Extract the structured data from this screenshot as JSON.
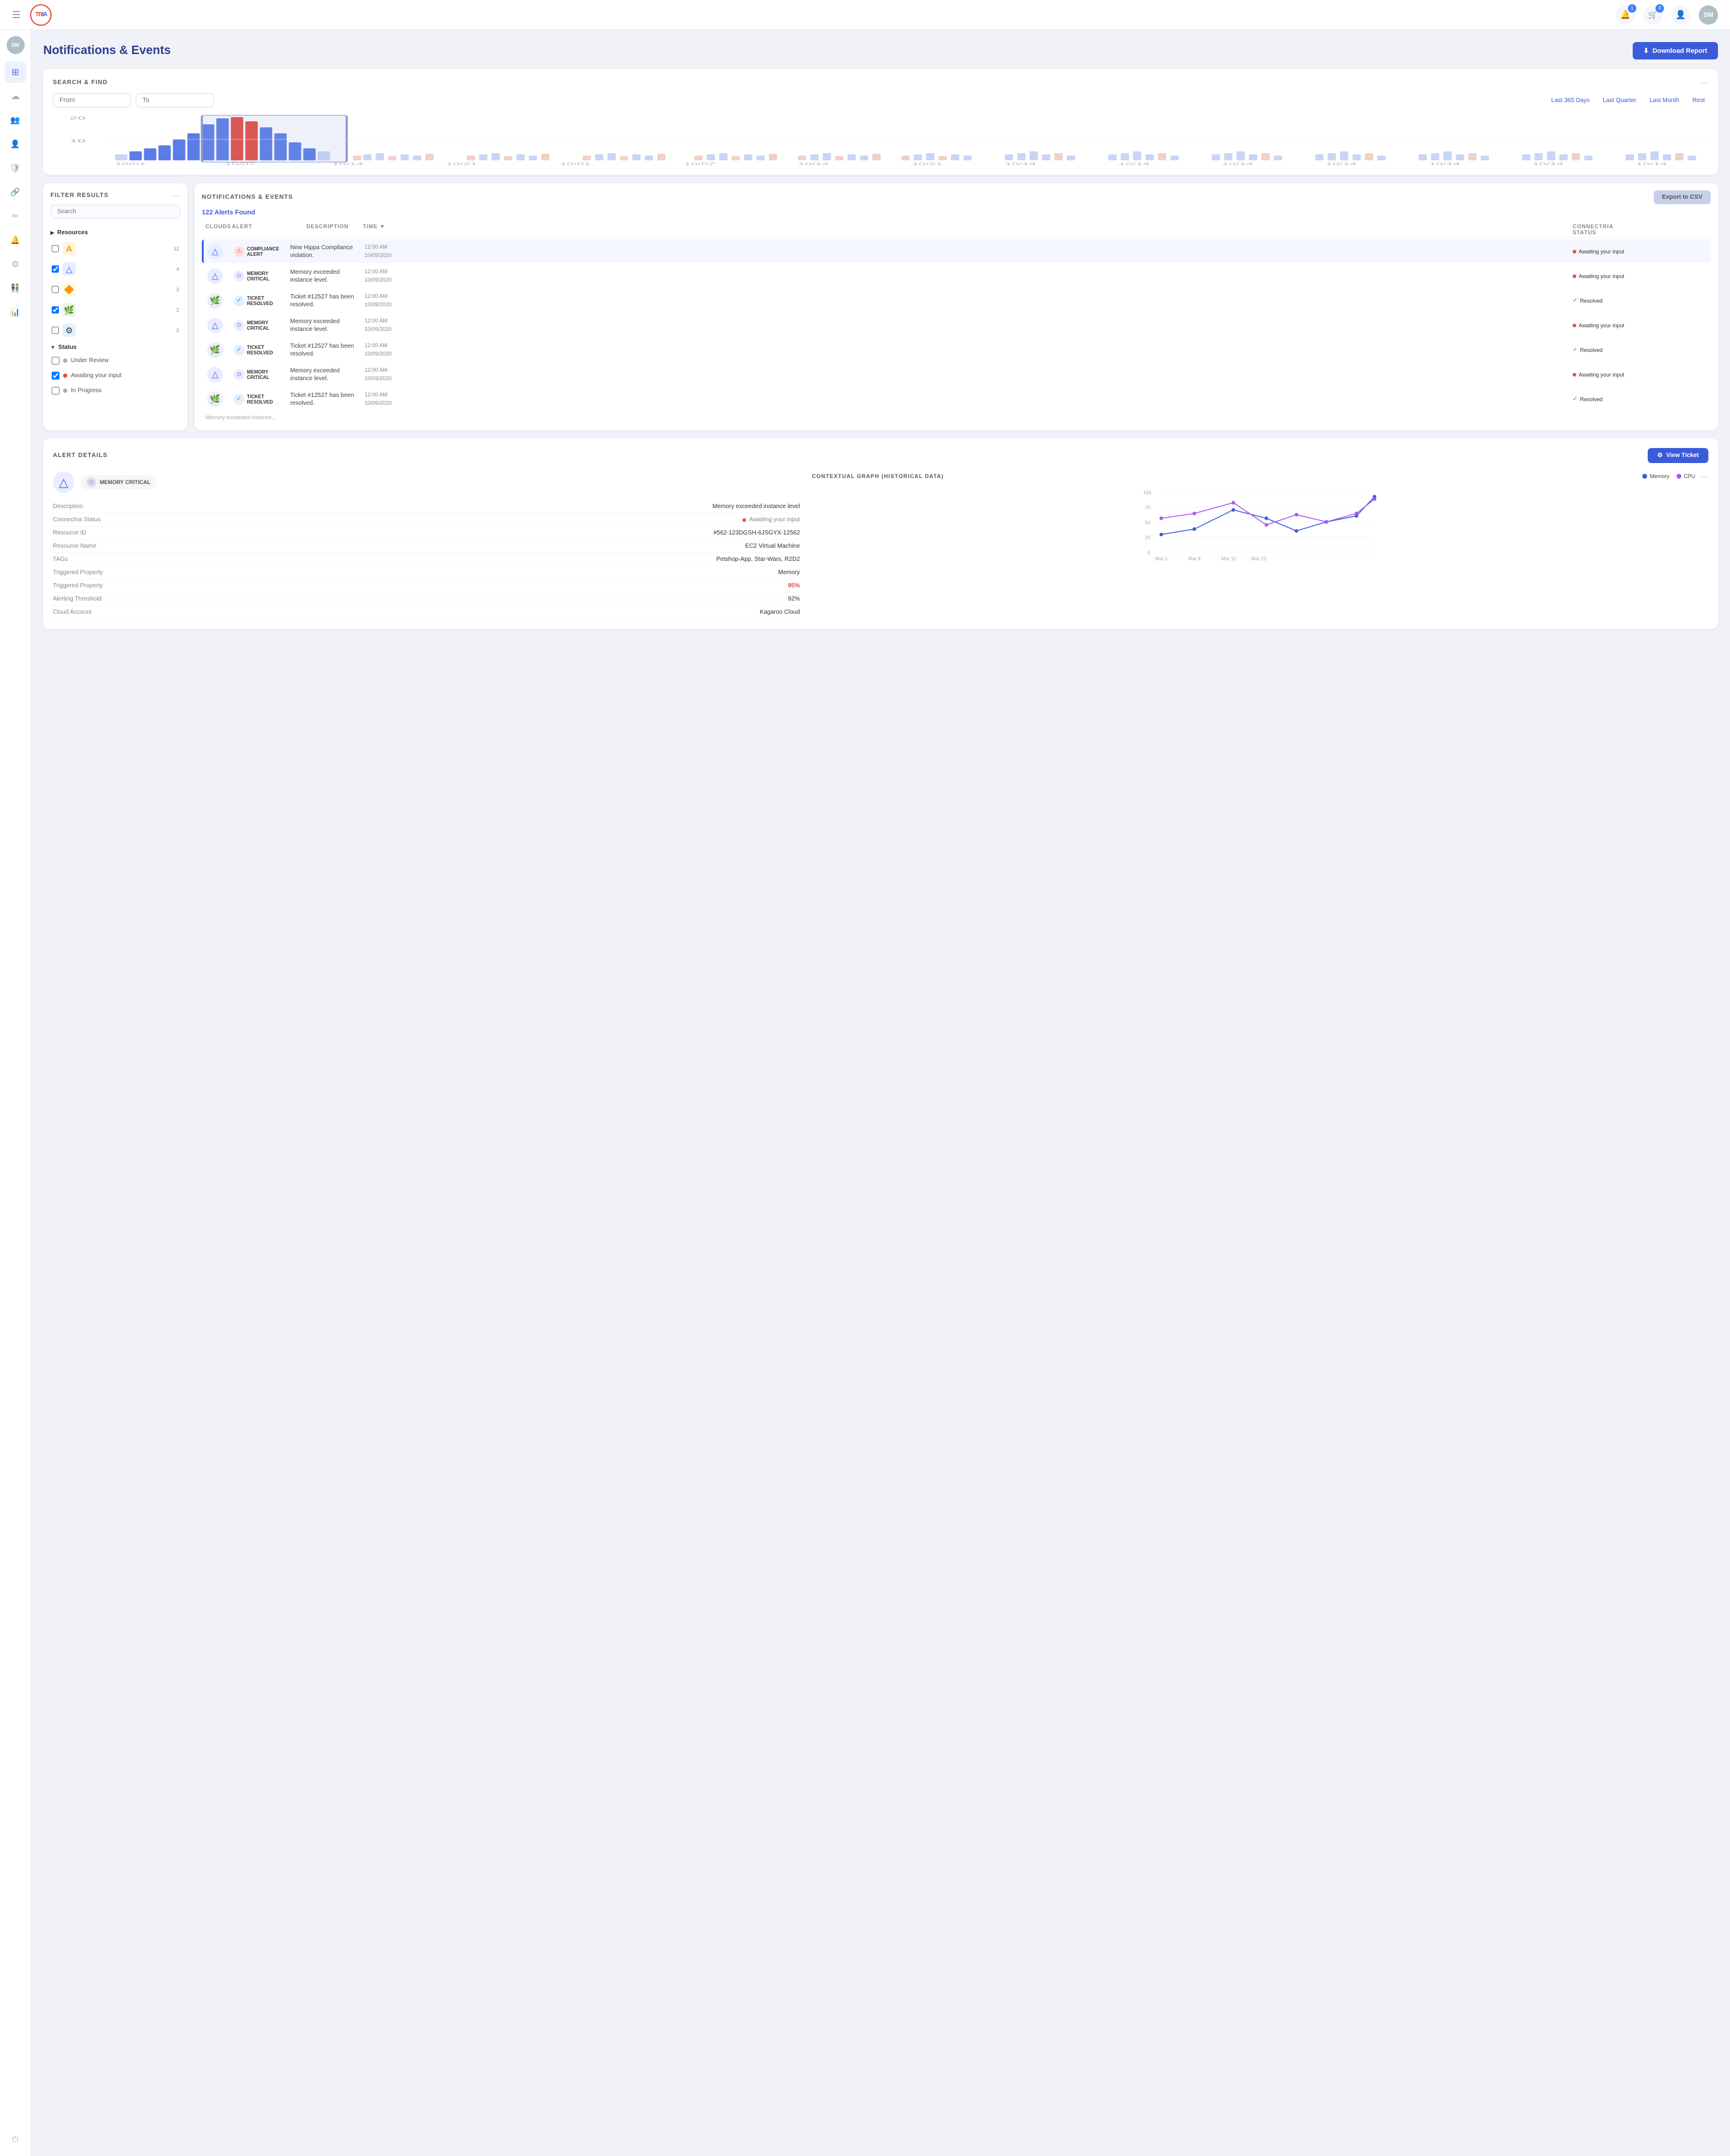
{
  "app": {
    "title": "TRIA",
    "user_initials": "SM"
  },
  "nav": {
    "bell_count": "1",
    "cart_count": "0",
    "user_initials": "SM"
  },
  "page": {
    "title": "Notifications & Events",
    "download_btn": "Download Report"
  },
  "search_panel": {
    "title": "SEARCH & FIND",
    "from_placeholder": "From",
    "to_placeholder": "To",
    "quick_filters": [
      "Last 365 Days",
      "Last Quarter",
      "Last Month",
      "Rest"
    ]
  },
  "filter_panel": {
    "title": "FILTER RESULTS",
    "search_placeholder": "Search",
    "resources_label": "Resources",
    "resources": [
      {
        "name": "Amazon",
        "icon": "🅰",
        "badge": "12",
        "checked": false
      },
      {
        "name": "Azure",
        "icon": "🔷",
        "badge": "4",
        "checked": true
      },
      {
        "name": "Google",
        "icon": "🔶",
        "badge": "3",
        "checked": false
      },
      {
        "name": "Custom",
        "icon": "🌿",
        "badge": "2",
        "checked": true
      },
      {
        "name": "K8s",
        "icon": "⚙",
        "badge": "2",
        "checked": false
      }
    ],
    "status_label": "Status",
    "statuses": [
      {
        "label": "Under Review",
        "color": "#a0aec0",
        "checked": false
      },
      {
        "label": "Awaiting your input",
        "color": "#e74c3c",
        "checked": true
      },
      {
        "label": "In Progress",
        "color": "#a0aec0",
        "checked": false
      }
    ]
  },
  "notifications": {
    "title": "NOTIFICATIONS & EVENTS",
    "export_btn": "Export to CSV",
    "alerts_found": "122 Alerts Found",
    "columns": [
      "CLOUDS",
      "ALERT",
      "DESCRIPTION",
      "TIME",
      "CONNECTRIA STATUS"
    ],
    "rows": [
      {
        "cloud": "azure",
        "alert_type": "COMPLIANCE ALERT",
        "alert_icon_color": "#e74c3c",
        "description": "New Hippa Compliance violation.",
        "time": "12:00 AM",
        "date": "10/09/2020",
        "status": "Awaiting your input",
        "status_color": "#e74c3c",
        "status_resolved": false,
        "selected": true
      },
      {
        "cloud": "azure",
        "alert_type": "MEMORY CRITICAL",
        "alert_icon_color": "#7b8cde",
        "description": "Memory exceeded instance level.",
        "time": "12:00 AM",
        "date": "10/09/2020",
        "status": "Awaiting your input",
        "status_color": "#e74c3c",
        "status_resolved": false,
        "selected": false
      },
      {
        "cloud": "custom",
        "alert_type": "TICKET RESOLVED",
        "alert_icon_color": "#3b82f6",
        "description": "Ticket #12527 has been resolved.",
        "time": "12:00 AM",
        "date": "10/09/2020",
        "status": "Resolved",
        "status_color": "#3b82f6",
        "status_resolved": true,
        "selected": false
      },
      {
        "cloud": "azure",
        "alert_type": "MEMORY CRITICAL",
        "alert_icon_color": "#7b8cde",
        "description": "Memory exceeded instance level.",
        "time": "12:00 AM",
        "date": "10/09/2020",
        "status": "Awaiting your input",
        "status_color": "#e74c3c",
        "status_resolved": false,
        "selected": false
      },
      {
        "cloud": "custom",
        "alert_type": "TICKET RESOLVED",
        "alert_icon_color": "#3b82f6",
        "description": "Ticket #12527 has been resolved.",
        "time": "12:00 AM",
        "date": "10/09/2020",
        "status": "Resolved",
        "status_color": "#3b82f6",
        "status_resolved": true,
        "selected": false
      },
      {
        "cloud": "azure",
        "alert_type": "MEMORY CRITICAL",
        "alert_icon_color": "#7b8cde",
        "description": "Memory exceeded instance level.",
        "time": "12:00 AM",
        "date": "10/03/2020",
        "status": "Awaiting your input",
        "status_color": "#e74c3c",
        "status_resolved": false,
        "selected": false
      },
      {
        "cloud": "custom",
        "alert_type": "TICKET RESOLVED",
        "alert_icon_color": "#3b82f6",
        "description": "Ticket #12527 has been resolved.",
        "time": "12:00 AM",
        "date": "10/09/2020",
        "status": "Resolved",
        "status_color": "#3b82f6",
        "status_resolved": true,
        "selected": false
      }
    ]
  },
  "alert_details": {
    "title": "ALERT DETAILS",
    "view_ticket_btn": "View Ticket",
    "alert_type": "MEMORY CRITICAL",
    "fields": [
      {
        "key": "Description",
        "value": "Memory exceeded instance level",
        "type": "text"
      },
      {
        "key": "Connectria Status",
        "value": "Awaiting your input",
        "type": "status"
      },
      {
        "key": "Resource ID",
        "value": "#562-123DGSH-6JSGYX-12562",
        "type": "text"
      },
      {
        "key": "Resource Name",
        "value": "EC2 Virtual Machine",
        "type": "text"
      },
      {
        "key": "TAGs",
        "value": "Petshop-App, Star-Wars, R2D2",
        "type": "text"
      },
      {
        "key": "Triggered Property",
        "value": "Memory",
        "type": "text"
      },
      {
        "key": "Triggered Property",
        "value": "95%",
        "type": "red"
      },
      {
        "key": "Alerting Threshold",
        "value": "92%",
        "type": "text"
      },
      {
        "key": "Cloud Account",
        "value": "Kagaroo Cloud",
        "type": "text"
      }
    ],
    "graph": {
      "title": "CONTEXTUAL GRAPH (HISTORICAL DATA)",
      "memory_label": "Memory",
      "cpu_label": "CPU",
      "memory_color": "#3b5bdb",
      "cpu_color": "#a855f7",
      "y_labels": [
        "100",
        "75",
        "50",
        "25",
        "0"
      ],
      "x_labels": [
        "Mar 1",
        "Mar 8",
        "Mar 15",
        "Mar 22"
      ],
      "memory_points": [
        28,
        42,
        72,
        55,
        35,
        50,
        62,
        70,
        90
      ],
      "cpu_points": [
        55,
        65,
        80,
        45,
        60,
        50,
        65,
        72,
        85
      ]
    }
  },
  "sidebar": {
    "items": [
      {
        "icon": "⊞",
        "label": "Dashboard",
        "active": true
      },
      {
        "icon": "☁",
        "label": "Cloud",
        "active": false
      },
      {
        "icon": "👥",
        "label": "Users top",
        "active": false
      },
      {
        "icon": "👤",
        "label": "Profile",
        "active": false
      },
      {
        "icon": "🛡",
        "label": "Security",
        "active": false
      },
      {
        "icon": "🔗",
        "label": "Connections",
        "active": false
      },
      {
        "icon": "✏",
        "label": "Edit",
        "active": false
      },
      {
        "icon": "🔔",
        "label": "Alerts",
        "active": false
      },
      {
        "icon": "⚙",
        "label": "Settings",
        "active": false
      },
      {
        "icon": "👫",
        "label": "Team",
        "active": false
      },
      {
        "icon": "📊",
        "label": "Reports",
        "active": false
      },
      {
        "icon": "⏻",
        "label": "Power",
        "active": false
      }
    ]
  }
}
